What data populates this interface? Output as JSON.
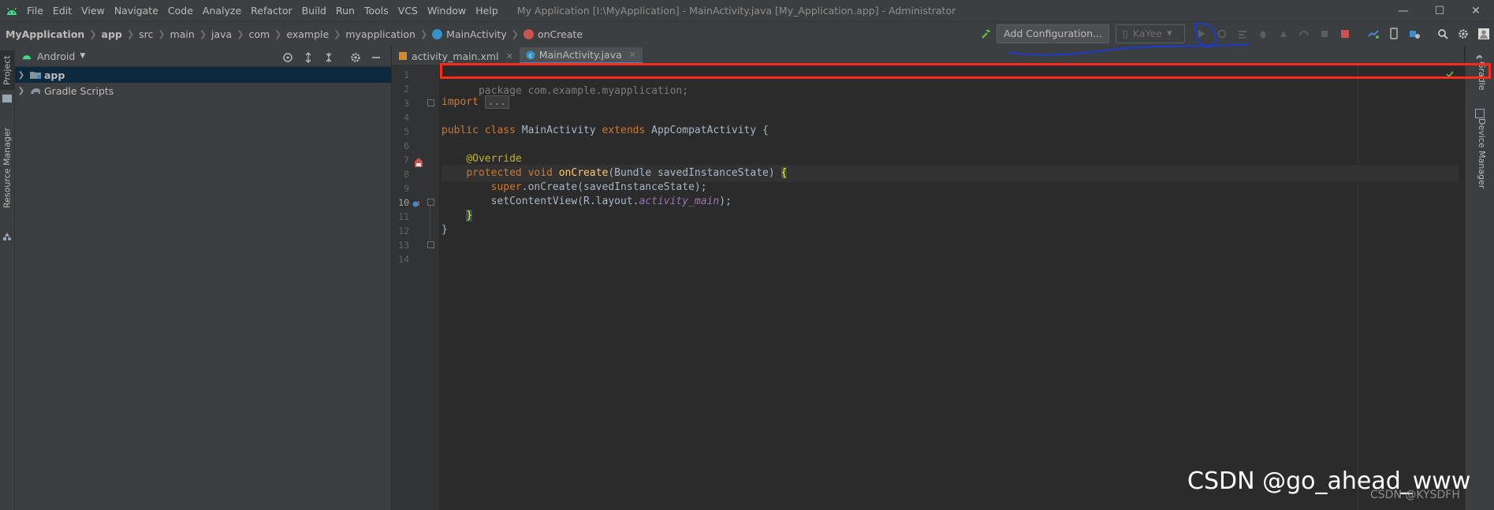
{
  "menubar": {
    "items": [
      "File",
      "Edit",
      "View",
      "Navigate",
      "Code",
      "Analyze",
      "Refactor",
      "Build",
      "Run",
      "Tools",
      "VCS",
      "Window",
      "Help"
    ],
    "window_title": "My Application [I:\\MyApplication] - MainActivity.java [My_Application.app] - Administrator"
  },
  "breadcrumbs": [
    "MyApplication",
    "app",
    "src",
    "main",
    "java",
    "com",
    "example",
    "myapplication",
    "MainActivity",
    "onCreate"
  ],
  "toolbar": {
    "add_config_label": "Add Configuration...",
    "device_label": "KaYee"
  },
  "left_strip": {
    "project_label": "Project",
    "resource_manager_label": "Resource Manager"
  },
  "project_panel": {
    "view_label": "Android",
    "tree": [
      {
        "label": "app",
        "selected": true
      },
      {
        "label": "Gradle Scripts",
        "selected": false
      }
    ]
  },
  "tabs": [
    {
      "label": "activity_main.xml",
      "active": false
    },
    {
      "label": "MainActivity.java",
      "active": true
    }
  ],
  "editor": {
    "line_numbers": [
      "1",
      "2",
      "3",
      "4",
      "5",
      "6",
      "7",
      "8",
      "9",
      "10",
      "11",
      "12",
      "13",
      "14"
    ],
    "current_line": "10",
    "code": {
      "line1": "package com.example.myapplication;",
      "line3_kw": "import",
      "line3_fold": "...",
      "line7_public": "public",
      "line7_class": "class",
      "line7_name": "MainActivity",
      "line7_extends": "extends",
      "line7_rest": "AppCompatActivity {",
      "line9_annotation": "@Override",
      "line10_protected": "protected",
      "line10_void": "void",
      "line10_fn": "onCreate",
      "line10_params": "(Bundle savedInstanceState) ",
      "line10_brace": "{",
      "line11_super": "super",
      "line11_rest": ".onCreate(savedInstanceState);",
      "line12_pre": "setContentView(R.layout.",
      "line12_it": "activity_main",
      "line12_post": ");",
      "line13_brace": "}",
      "line14_brace": "}"
    }
  },
  "right_strip": {
    "gradle_label": "Gradle",
    "device_manager_label": "Device Manager"
  },
  "watermark": {
    "main": "CSDN @go_ahead_www",
    "sub": "CSDN @KYSDFH"
  },
  "colors": {
    "highlight_box": "#ff2a1a",
    "annotation_pen": "#1a3ad6"
  }
}
